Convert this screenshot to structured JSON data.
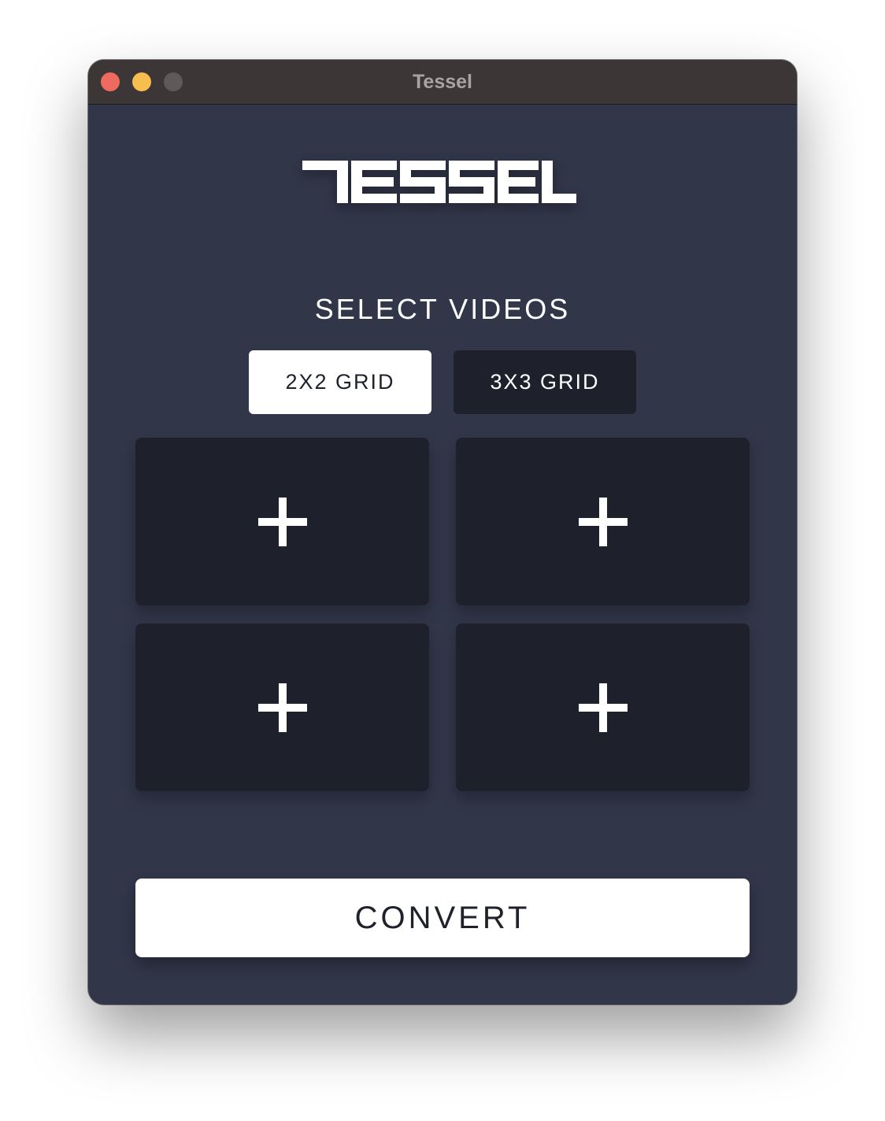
{
  "window": {
    "title": "Tessel",
    "controls": [
      "close",
      "minimize",
      "zoom"
    ]
  },
  "logo": {
    "text": "TESSEL"
  },
  "heading": "SELECT VIDEOS",
  "grid_options": [
    {
      "label": "2X2 GRID",
      "selected": true
    },
    {
      "label": "3X3 GRID",
      "selected": false
    }
  ],
  "video_slots": [
    {
      "icon": "plus-icon"
    },
    {
      "icon": "plus-icon"
    },
    {
      "icon": "plus-icon"
    },
    {
      "icon": "plus-icon"
    }
  ],
  "convert_label": "CONVERT",
  "colors": {
    "background": "#313649",
    "titlebar": "#3d3636",
    "slot": "#1e202b",
    "selected_button": "#ffffff",
    "unselected_button": "#1e212c",
    "close": "#ee6a5f",
    "minimize": "#f5be4f",
    "zoom": "#5e5a5a"
  }
}
